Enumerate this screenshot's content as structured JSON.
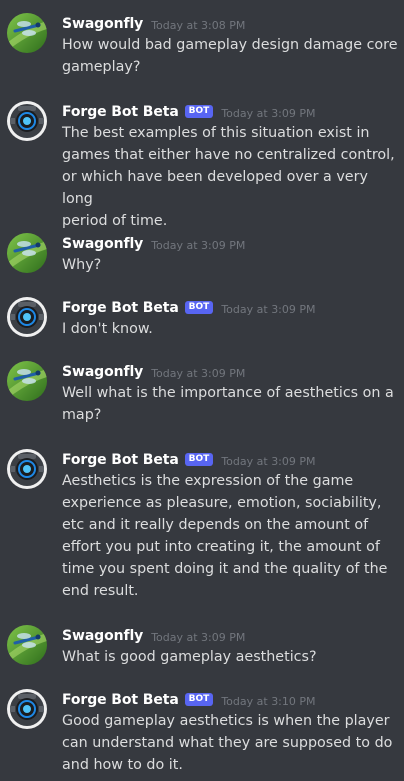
{
  "users": {
    "swagonfly": {
      "name": "Swagonfly",
      "avatar_icon": "dragonfly-leaf-avatar-icon"
    },
    "forge": {
      "name": "Forge Bot Beta",
      "bot_tag": "BOT",
      "avatar_icon": "robot-avatar-icon"
    }
  },
  "colors": {
    "background": "#36393f",
    "bot_tag": "#5865f2",
    "timestamp": "#72767d",
    "text": "#dcddde"
  },
  "messages": [
    {
      "author": "Swagonfly",
      "time": "Today at 3:08 PM",
      "lines": [
        "How would bad gameplay design damage core",
        "gameplay?"
      ]
    },
    {
      "author": "Forge Bot Beta",
      "bot": "BOT",
      "time": "Today at 3:09 PM",
      "lines": [
        "The best examples of this situation exist in",
        "games that either have no centralized control,",
        "or which have been developed over a very long",
        "period of time."
      ]
    },
    {
      "author": "Swagonfly",
      "time": "Today at 3:09 PM",
      "lines": [
        "Why?"
      ]
    },
    {
      "author": "Forge Bot Beta",
      "bot": "BOT",
      "time": "Today at 3:09 PM",
      "lines": [
        "I don't know."
      ]
    },
    {
      "author": "Swagonfly",
      "time": "Today at 3:09 PM",
      "lines": [
        "Well what is the importance of aesthetics on a",
        "map?"
      ]
    },
    {
      "author": "Forge Bot Beta",
      "bot": "BOT",
      "time": "Today at 3:09 PM",
      "lines": [
        "Aesthetics is the expression of the game",
        "experience as pleasure, emotion, sociability,",
        "etc and it really depends on the amount of",
        "effort you put into creating it, the amount of",
        "time you spent doing it and the quality of the",
        "end result."
      ]
    },
    {
      "author": "Swagonfly",
      "time": "Today at 3:09 PM",
      "lines": [
        "What is good gameplay aesthetics?"
      ]
    },
    {
      "author": "Forge Bot Beta",
      "bot": "BOT",
      "time": "Today at 3:10 PM",
      "lines": [
        "Good gameplay aesthetics is when the player",
        "can understand what they are supposed to do",
        "and how to do it."
      ]
    }
  ]
}
